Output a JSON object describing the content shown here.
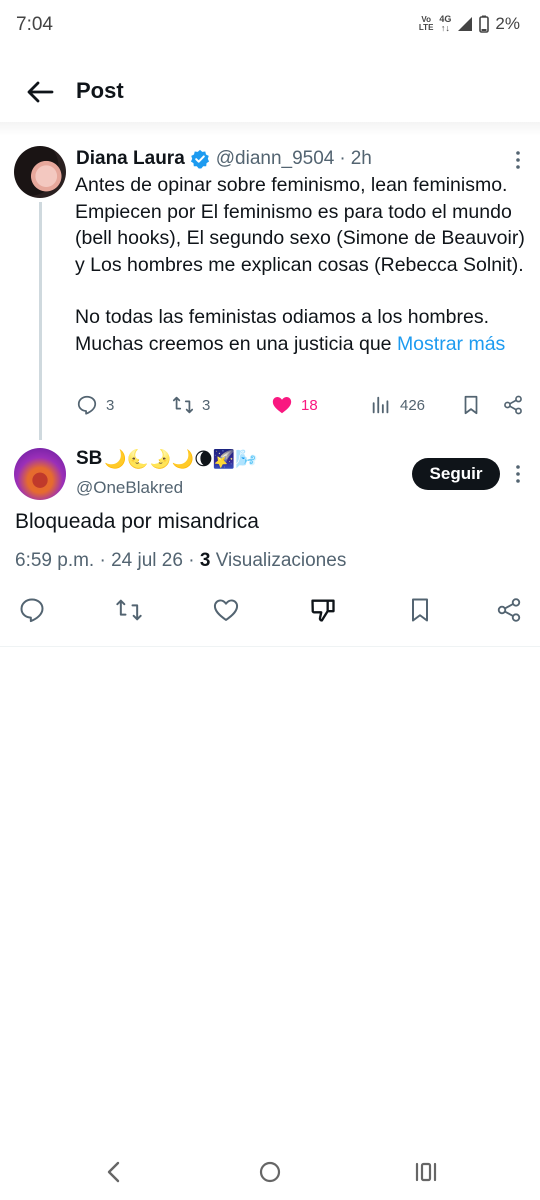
{
  "status_bar": {
    "time": "7:04",
    "volte_top": "Vo",
    "volte_bottom": "LTE",
    "network": "4G",
    "battery": "2%"
  },
  "header": {
    "title": "Post",
    "back_icon": "arrow-left-icon"
  },
  "parent_tweet": {
    "name": "Diana Laura",
    "handle": "@diann_9504",
    "separator": "·",
    "time": "2h",
    "paragraph1": "Antes de opinar sobre feminismo, lean feminismo. Empiecen por El feminismo es para todo el mundo (bell hooks), El segundo sexo (Simone de Beauvoir) y Los hombres me explican cosas (Rebecca Solnit).",
    "paragraph2": "No todas las feministas odiamos a los hombres. Muchas creemos en una justicia que",
    "show_more": "Mostrar más",
    "replies": "3",
    "retweets": "3",
    "likes": "18",
    "views": "426"
  },
  "reply_tweet": {
    "name": "SB",
    "emojis": "🌙🌜🌛🌙🌘🌠🌬️",
    "handle": "@OneBlakred",
    "follow_label": "Seguir",
    "text": "Bloqueada por misandrica",
    "time": "6:59 p.m.",
    "date": "24 jul 26",
    "view_count": "3",
    "views_label": "Visualizaciones"
  },
  "colors": {
    "accent": "#1d9bf0",
    "like": "#f91880",
    "secondary_text": "#536471",
    "primary_text": "#0f1419"
  }
}
